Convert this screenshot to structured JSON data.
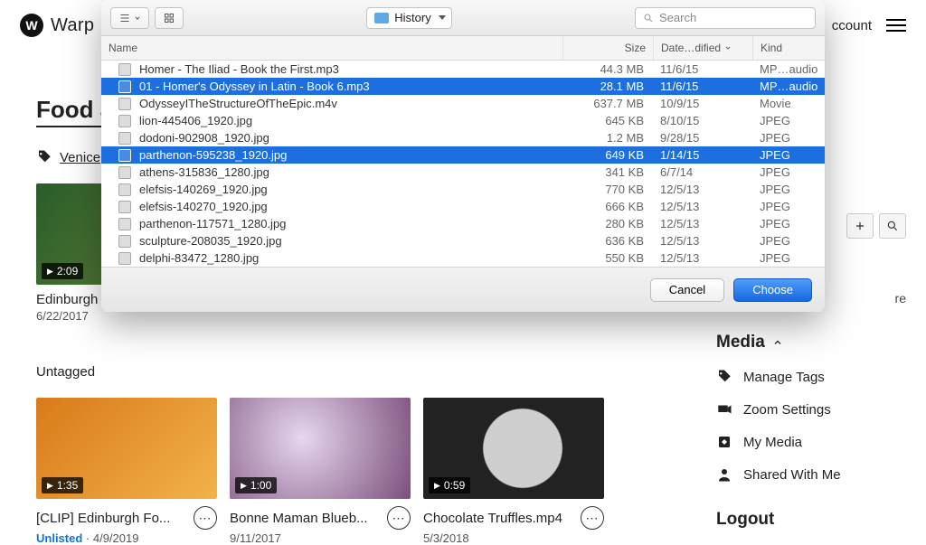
{
  "brand": {
    "initial": "W",
    "name": "Warp"
  },
  "header": {
    "account": "ccount"
  },
  "page": {
    "title": "Food an",
    "tag_link": "Venice",
    "untagged_label": "Untagged"
  },
  "hero_card": {
    "duration": "2:09",
    "title": "Edinburgh",
    "meta": "6/22/2017"
  },
  "cards": [
    {
      "duration": "1:35",
      "title": "[CLIP] Edinburgh Fo...",
      "unlisted": "Unlisted",
      "sep": " · ",
      "date": "4/9/2019"
    },
    {
      "duration": "1:00",
      "title": "Bonne Maman Blueb...",
      "date": "9/11/2017"
    },
    {
      "duration": "0:59",
      "title": "Chocolate Truffles.mp4",
      "date": "5/3/2018"
    }
  ],
  "right": {
    "more": "re",
    "media_heading": "Media",
    "items": [
      "Manage Tags",
      "Zoom Settings",
      "My Media",
      "Shared With Me"
    ],
    "logout": "Logout"
  },
  "sheet": {
    "folder": "History",
    "search_placeholder": "Search",
    "columns": {
      "name": "Name",
      "size": "Size",
      "date": "Date…dified",
      "kind": "Kind"
    },
    "files": [
      {
        "name": "Homer - The Iliad - Book the First.mp3",
        "size": "44.3 MB",
        "date": "11/6/15",
        "kind": "MP…audio",
        "sel": false
      },
      {
        "name": "01 - Homer's Odyssey in Latin - Book 6.mp3",
        "size": "28.1 MB",
        "date": "11/6/15",
        "kind": "MP…audio",
        "sel": true
      },
      {
        "name": "OdysseyITheStructureOfTheEpic.m4v",
        "size": "637.7 MB",
        "date": "10/9/15",
        "kind": "Movie",
        "sel": false
      },
      {
        "name": "lion-445406_1920.jpg",
        "size": "645 KB",
        "date": "8/10/15",
        "kind": "JPEG",
        "sel": false
      },
      {
        "name": "dodoni-902908_1920.jpg",
        "size": "1.2 MB",
        "date": "9/28/15",
        "kind": "JPEG",
        "sel": false
      },
      {
        "name": "parthenon-595238_1920.jpg",
        "size": "649 KB",
        "date": "1/14/15",
        "kind": "JPEG",
        "sel": true
      },
      {
        "name": "athens-315836_1280.jpg",
        "size": "341 KB",
        "date": "6/7/14",
        "kind": "JPEG",
        "sel": false
      },
      {
        "name": "elefsis-140269_1920.jpg",
        "size": "770 KB",
        "date": "12/5/13",
        "kind": "JPEG",
        "sel": false
      },
      {
        "name": "elefsis-140270_1920.jpg",
        "size": "666 KB",
        "date": "12/5/13",
        "kind": "JPEG",
        "sel": false
      },
      {
        "name": "parthenon-117571_1280.jpg",
        "size": "280 KB",
        "date": "12/5/13",
        "kind": "JPEG",
        "sel": false
      },
      {
        "name": "sculpture-208035_1920.jpg",
        "size": "636 KB",
        "date": "12/5/13",
        "kind": "JPEG",
        "sel": false
      },
      {
        "name": "delphi-83472_1280.jpg",
        "size": "550 KB",
        "date": "12/5/13",
        "kind": "JPEG",
        "sel": false
      }
    ],
    "cancel": "Cancel",
    "choose": "Choose"
  }
}
